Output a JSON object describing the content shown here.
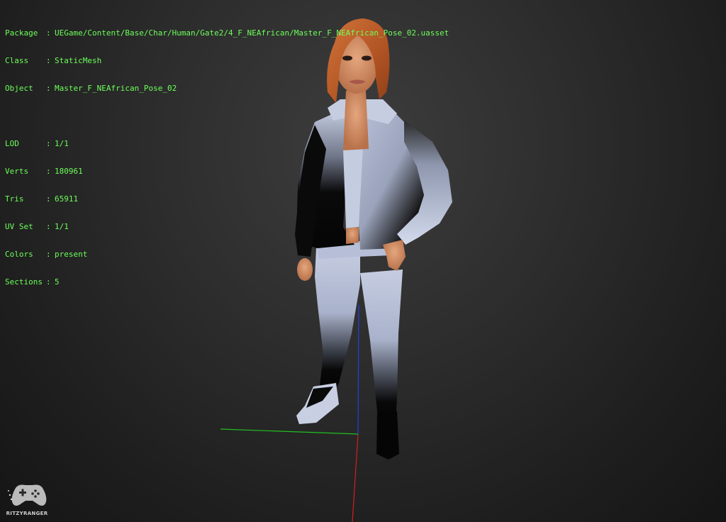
{
  "info": {
    "package": {
      "key": "Package",
      "value": "UEGame/Content/Base/Char/Human/Gate2/4_F_NEAfrican/Master_F_NEAfrican_Pose_02.uasset"
    },
    "class": {
      "key": "Class",
      "value": "StaticMesh"
    },
    "object": {
      "key": "Object",
      "value": "Master_F_NEAfrican_Pose_02"
    },
    "lod": {
      "key": "LOD",
      "value": "1/1"
    },
    "verts": {
      "key": "Verts",
      "value": "180961"
    },
    "tris": {
      "key": "Tris",
      "value": "65911"
    },
    "uvset": {
      "key": "UV Set",
      "value": "1/1"
    },
    "colors": {
      "key": "Colors",
      "value": "present"
    },
    "sections": {
      "key": "Sections",
      "value": "5"
    },
    "separator": ":"
  },
  "watermark": {
    "text": "RITZYRANGER",
    "icon": "gamepad-icon"
  },
  "colors": {
    "overlay_text": "#6cff5a",
    "axis_x": "#d42020",
    "axis_y": "#20c020",
    "axis_z": "#2040e0",
    "hair": "#c0622c",
    "skin": "#d9956c",
    "garment_light": "#b9c3dd",
    "garment_dark": "#050505"
  }
}
